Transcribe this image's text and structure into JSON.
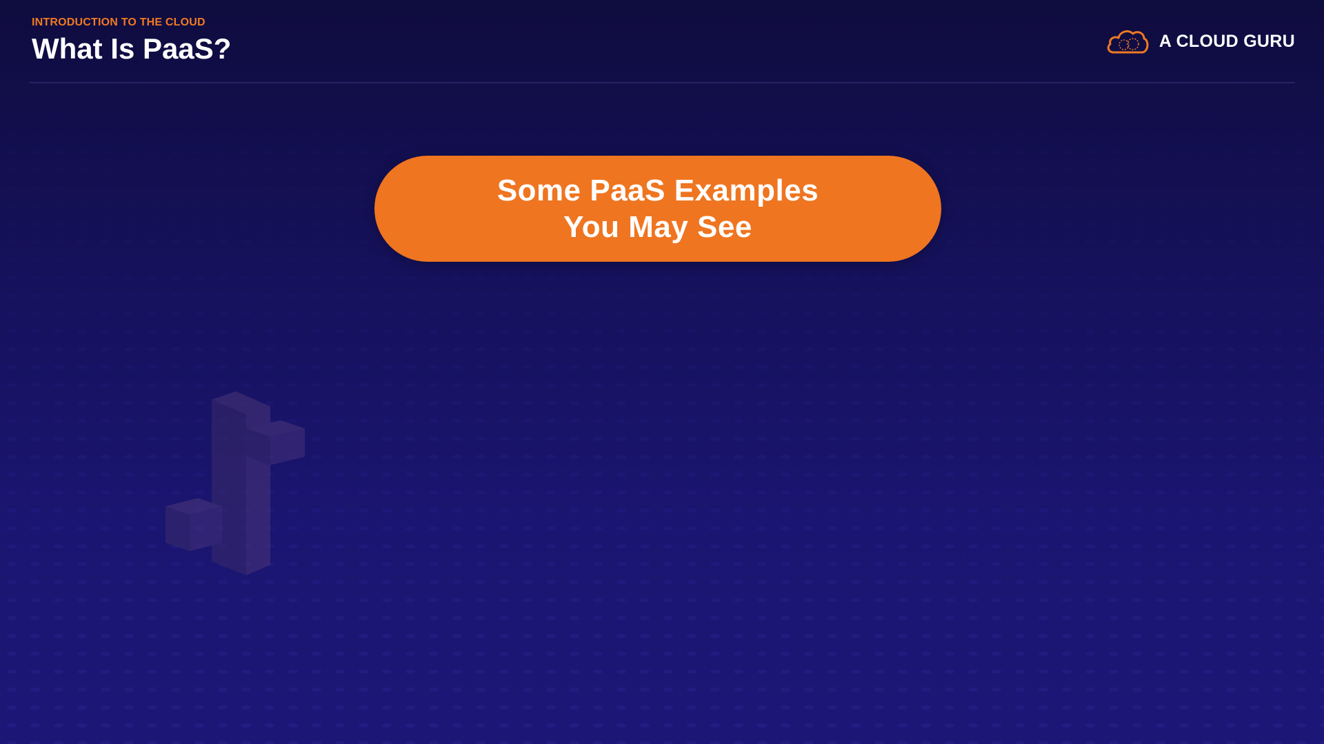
{
  "header": {
    "subtitle": "INTRODUCTION TO THE CLOUD",
    "title": "What Is PaaS?"
  },
  "brand": {
    "name": "A CLOUD GURU",
    "logo_icon": "cloud-icon",
    "logo_color": "#f07a22"
  },
  "hero": {
    "line1": "Some PaaS Examples",
    "line2": "You May See",
    "background_color": "#ef7520"
  },
  "decoration": {
    "icon": "elastic-beanstalk-blocks-icon"
  },
  "colors": {
    "background_top": "#0f0c3f",
    "background_bottom": "#1c1777",
    "accent": "#f07a22",
    "text": "#ffffff"
  }
}
